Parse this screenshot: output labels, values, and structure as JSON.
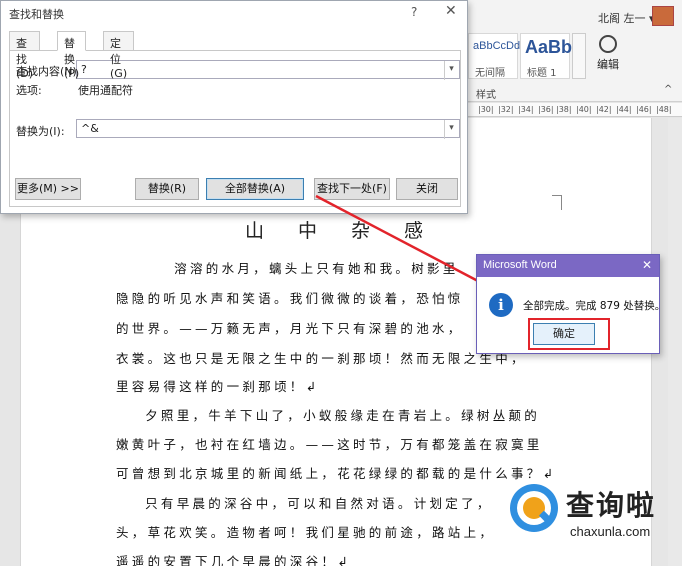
{
  "ribbon": {
    "user_name": "北阁 左一 ▾",
    "style_previews": [
      {
        "preview": "aBbCcDd",
        "name": "无间隔"
      },
      {
        "preview": "AaBb",
        "name": "标题 1"
      }
    ],
    "edit_label": "编辑",
    "styles_group_label": "样式",
    "collapse_glyph": "^"
  },
  "ruler": [
    "|30|",
    "|32|",
    "|34|",
    "|36|",
    "|38|",
    "|40|",
    "|42|",
    "|44|",
    "|46|",
    "|48|"
  ],
  "document": {
    "title": "山 中 杂 感",
    "lines": [
      "        溶溶的水月，螭头上只有她和我。树影里",
      "隐隐的听见水声和笑语。我们微微的谈着，恐怕惊",
      "的世界。——万籁无声，月光下只有深碧的池水，",
      "衣裳。这也只是无限之生中的一刹那顷！然而无限之生中，",
      "里容易得这样的一刹那顷！↲",
      "    夕照里，牛羊下山了，小蚁般缘走在青岩上。绿树丛颠的",
      "嫩黄叶子，也衬在红墙边。——这时节，万有都笼盖在寂寞里",
      "可曾想到北京城里的新闻纸上，花花绿绿的都载的是什么事？↲",
      "    只有早晨的深谷中，可以和自然对语。计划定了，",
      "头，草花欢笑。造物者呵！我们星驰的前途，路站上，",
      "遥遥的安置下几个早晨的深谷！↲"
    ]
  },
  "find_replace": {
    "title": "查找和替换",
    "help": "?",
    "close": "✕",
    "tabs": [
      "查找(D)",
      "替换(P)",
      "定位(G)"
    ],
    "find_label": "查找内容(N):",
    "find_value": "?",
    "options_label": "选项:",
    "options_value": "使用通配符",
    "replace_label": "替换为(I):",
    "replace_value": "^&",
    "dropdown_glyph": "▾",
    "buttons": {
      "more": "更多(M) >>",
      "replace": "替换(R)",
      "replace_all": "全部替换(A)",
      "find_next": "查找下一处(F)",
      "close": "关闭"
    }
  },
  "message_box": {
    "title": "Microsoft Word",
    "close": "✕",
    "icon": "i",
    "text": "全部完成。完成 879 处替换。",
    "ok": "确定"
  },
  "watermark": {
    "name": "查询啦",
    "domain": "chaxunla.com"
  },
  "colors": {
    "highlight_red": "#e2242b",
    "msg_titlebar": "#7b68c4",
    "info_blue": "#1e6ac2"
  }
}
